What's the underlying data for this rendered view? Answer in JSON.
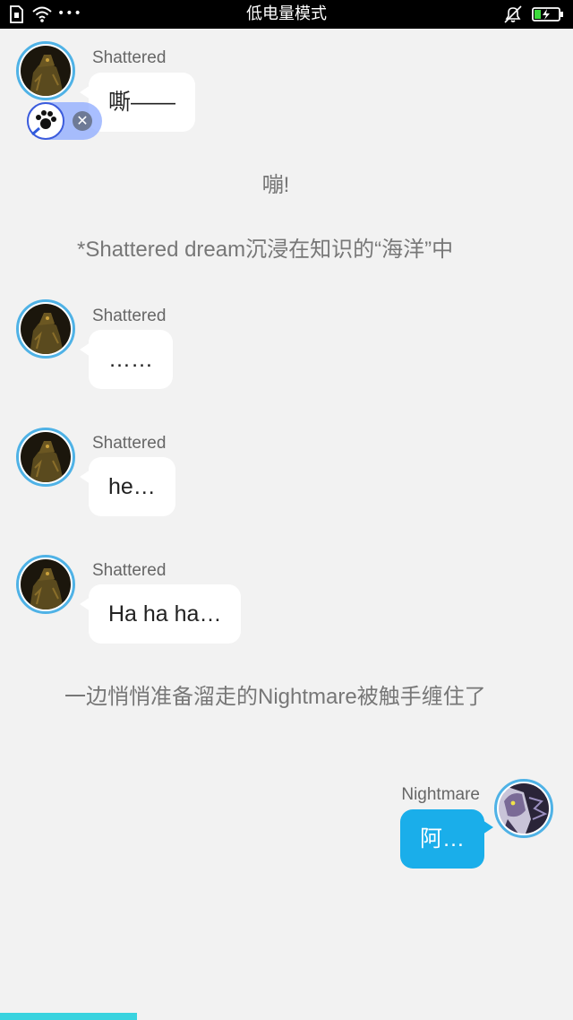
{
  "status_bar": {
    "title": "低电量模式",
    "dots": "•••"
  },
  "messages": [
    {
      "type": "received",
      "sender": "Shattered",
      "text": "嘶——"
    },
    {
      "type": "narration",
      "text": "嘣!"
    },
    {
      "type": "narration",
      "text": "*Shattered dream沉浸在知识的“海洋”中"
    },
    {
      "type": "received",
      "sender": "Shattered",
      "text": "……"
    },
    {
      "type": "received",
      "sender": "Shattered",
      "text": "he…"
    },
    {
      "type": "received",
      "sender": "Shattered",
      "text": "Ha ha ha…"
    },
    {
      "type": "narration",
      "text": "一边悄悄准备溜走的Nightmare被触手缠住了"
    },
    {
      "type": "sent",
      "sender": "Nightmare",
      "text": "阿…"
    }
  ],
  "overlay": {
    "close_glyph": "✕"
  },
  "colors": {
    "accent": "#1aaeea",
    "avatar_ring": "#4fb2e6",
    "progress": "#39d3df"
  },
  "icons": [
    "sim-icon",
    "wifi-icon",
    "silent-bell-icon",
    "battery-charging-icon",
    "paw-icon",
    "close-icon"
  ]
}
